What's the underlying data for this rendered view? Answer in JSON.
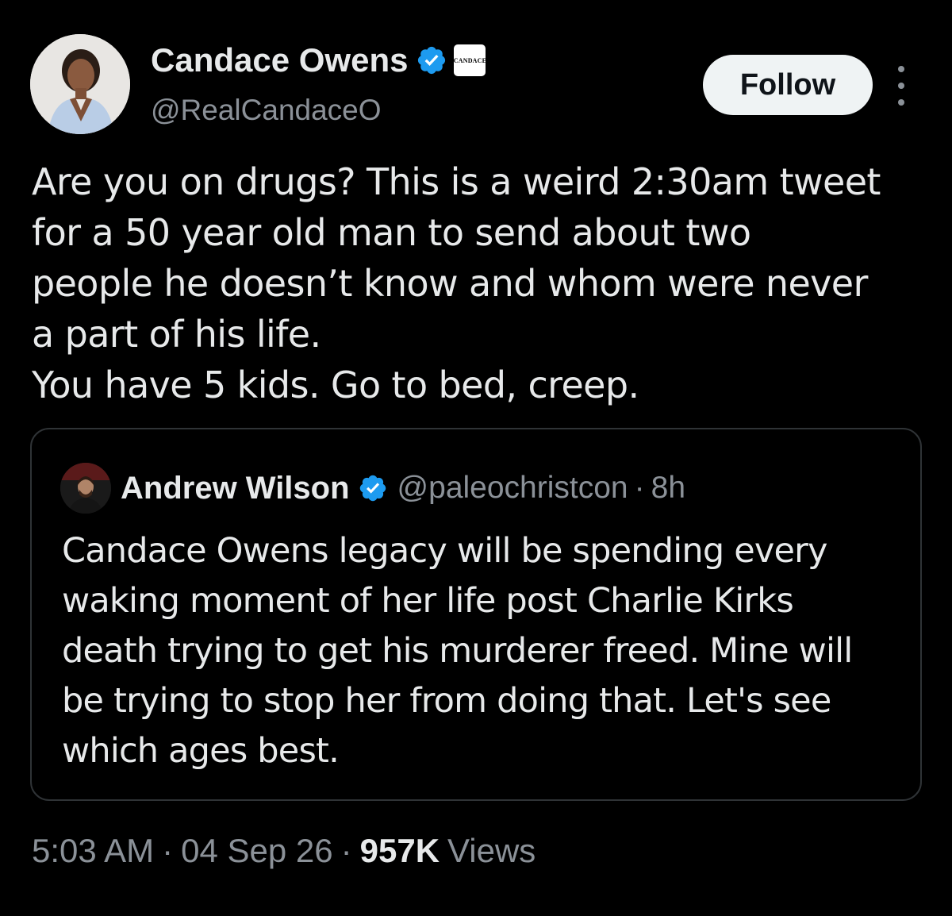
{
  "tweet": {
    "author": {
      "name": "Candace Owens",
      "handle": "@RealCandaceO",
      "affiliate_badge_text": "CANDACE",
      "verified": true
    },
    "follow_label": "Follow",
    "text_lines": [
      "Are you on drugs? This is a weird 2:30am tweet",
      "for a 50 year old man to send about two",
      "people he doesn’t know and whom were never",
      "a part of his life.",
      "You have 5 kids. Go to bed, creep."
    ],
    "quoted": {
      "name": "Andrew Wilson",
      "handle": "@paleochristcon",
      "separator": "·",
      "time": "8h",
      "verified": true,
      "text_lines": [
        "Candace Owens legacy will be spending every",
        "waking moment of her life post Charlie Kirks",
        "death trying to get his murderer freed. Mine will",
        "be trying to stop her from doing that. Let's see",
        "which ages best."
      ]
    },
    "meta": {
      "time": "5:03 AM",
      "separator": "·",
      "date": "04 Sep 26",
      "views_count": "957K",
      "views_label": "Views"
    }
  },
  "colors": {
    "background": "#000000",
    "text": "#e7e9ea",
    "secondary_text": "#8b9198",
    "verified_blue": "#1d9bf0",
    "border": "#2f3336",
    "follow_button_bg": "#eff3f4"
  },
  "icons": [
    "verified-badge-icon",
    "more-options-icon"
  ]
}
